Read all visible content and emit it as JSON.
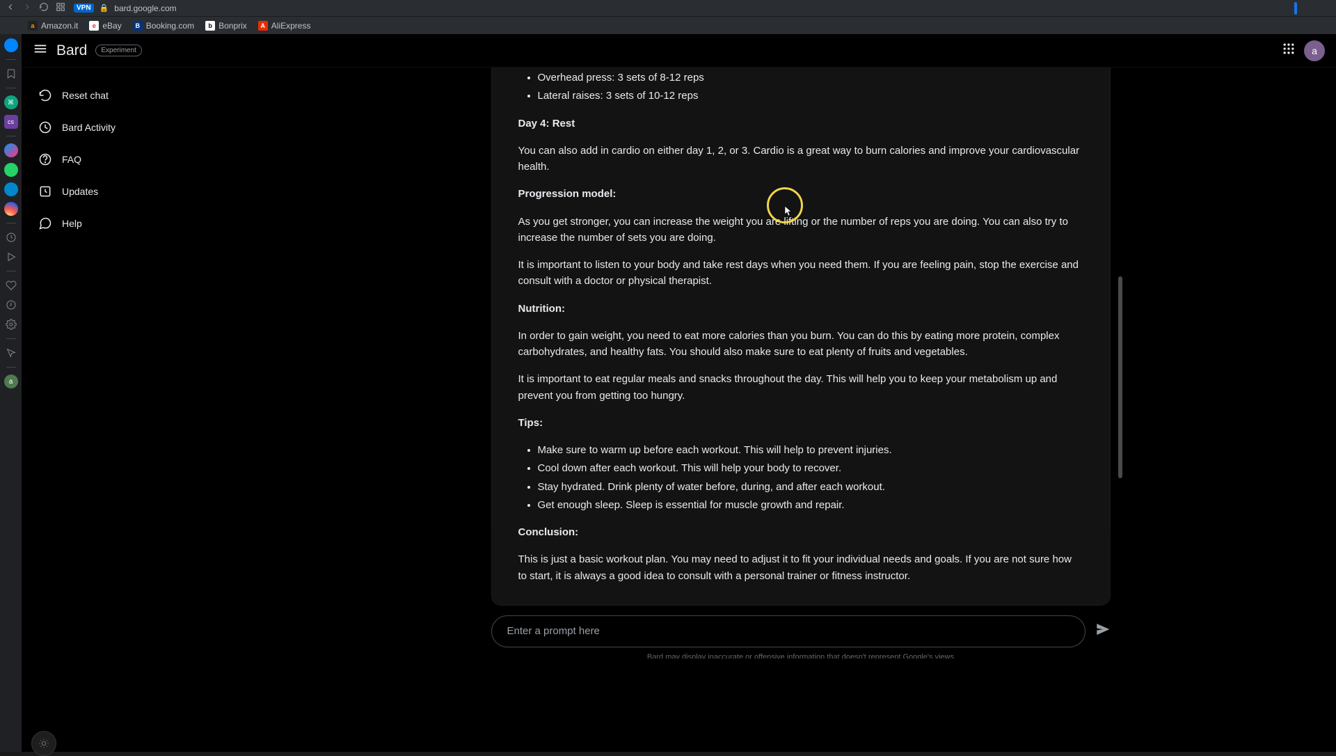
{
  "browser": {
    "vpn": "VPN",
    "url": "bard.google.com"
  },
  "bookmarks": [
    {
      "label": "Amazon.it",
      "fav": "a",
      "cls": "amazon"
    },
    {
      "label": "eBay",
      "fav": "e",
      "cls": "ebay"
    },
    {
      "label": "Booking.com",
      "fav": "B",
      "cls": "booking"
    },
    {
      "label": "Bonprix",
      "fav": "b",
      "cls": "bonprix"
    },
    {
      "label": "AliExpress",
      "fav": "A",
      "cls": "ali"
    }
  ],
  "header": {
    "brand": "Bard",
    "badge": "Experiment",
    "avatar": "a"
  },
  "nav": {
    "reset": "Reset chat",
    "activity": "Bard Activity",
    "faq": "FAQ",
    "updates": "Updates",
    "help": "Help"
  },
  "response": {
    "exercises": [
      "Overhead press: 3 sets of 8-12 reps",
      "Lateral raises: 3 sets of 10-12 reps"
    ],
    "day4": "Day 4: Rest",
    "cardio": "You can also add in cardio on either day 1, 2, or 3. Cardio is a great way to burn calories and improve your cardiovascular health.",
    "prog_h": "Progression model:",
    "prog1": "As you get stronger, you can increase the weight you are lifting or the number of reps you are doing. You can also try to increase the number of sets you are doing.",
    "prog2": "It is important to listen to your body and take rest days when you need them. If you are feeling pain, stop the exercise and consult with a doctor or physical therapist.",
    "nutr_h": "Nutrition:",
    "nutr1": "In order to gain weight, you need to eat more calories than you burn. You can do this by eating more protein, complex carbohydrates, and healthy fats. You should also make sure to eat plenty of fruits and vegetables.",
    "nutr2": "It is important to eat regular meals and snacks throughout the day. This will help you to keep your metabolism up and prevent you from getting too hungry.",
    "tips_h": "Tips:",
    "tips": [
      "Make sure to warm up before each workout. This will help to prevent injuries.",
      "Cool down after each workout. This will help your body to recover.",
      "Stay hydrated. Drink plenty of water before, during, and after each workout.",
      "Get enough sleep. Sleep is essential for muscle growth and repair."
    ],
    "conc_h": "Conclusion:",
    "conc": "This is just a basic workout plan. You may need to adjust it to fit your individual needs and goals. If you are not sure how to start, it is always a good idea to consult with a personal trainer or fitness instructor."
  },
  "input": {
    "placeholder": "Enter a prompt here"
  },
  "footer": "Bard may display inaccurate or offensive information that doesn't represent Google's views"
}
